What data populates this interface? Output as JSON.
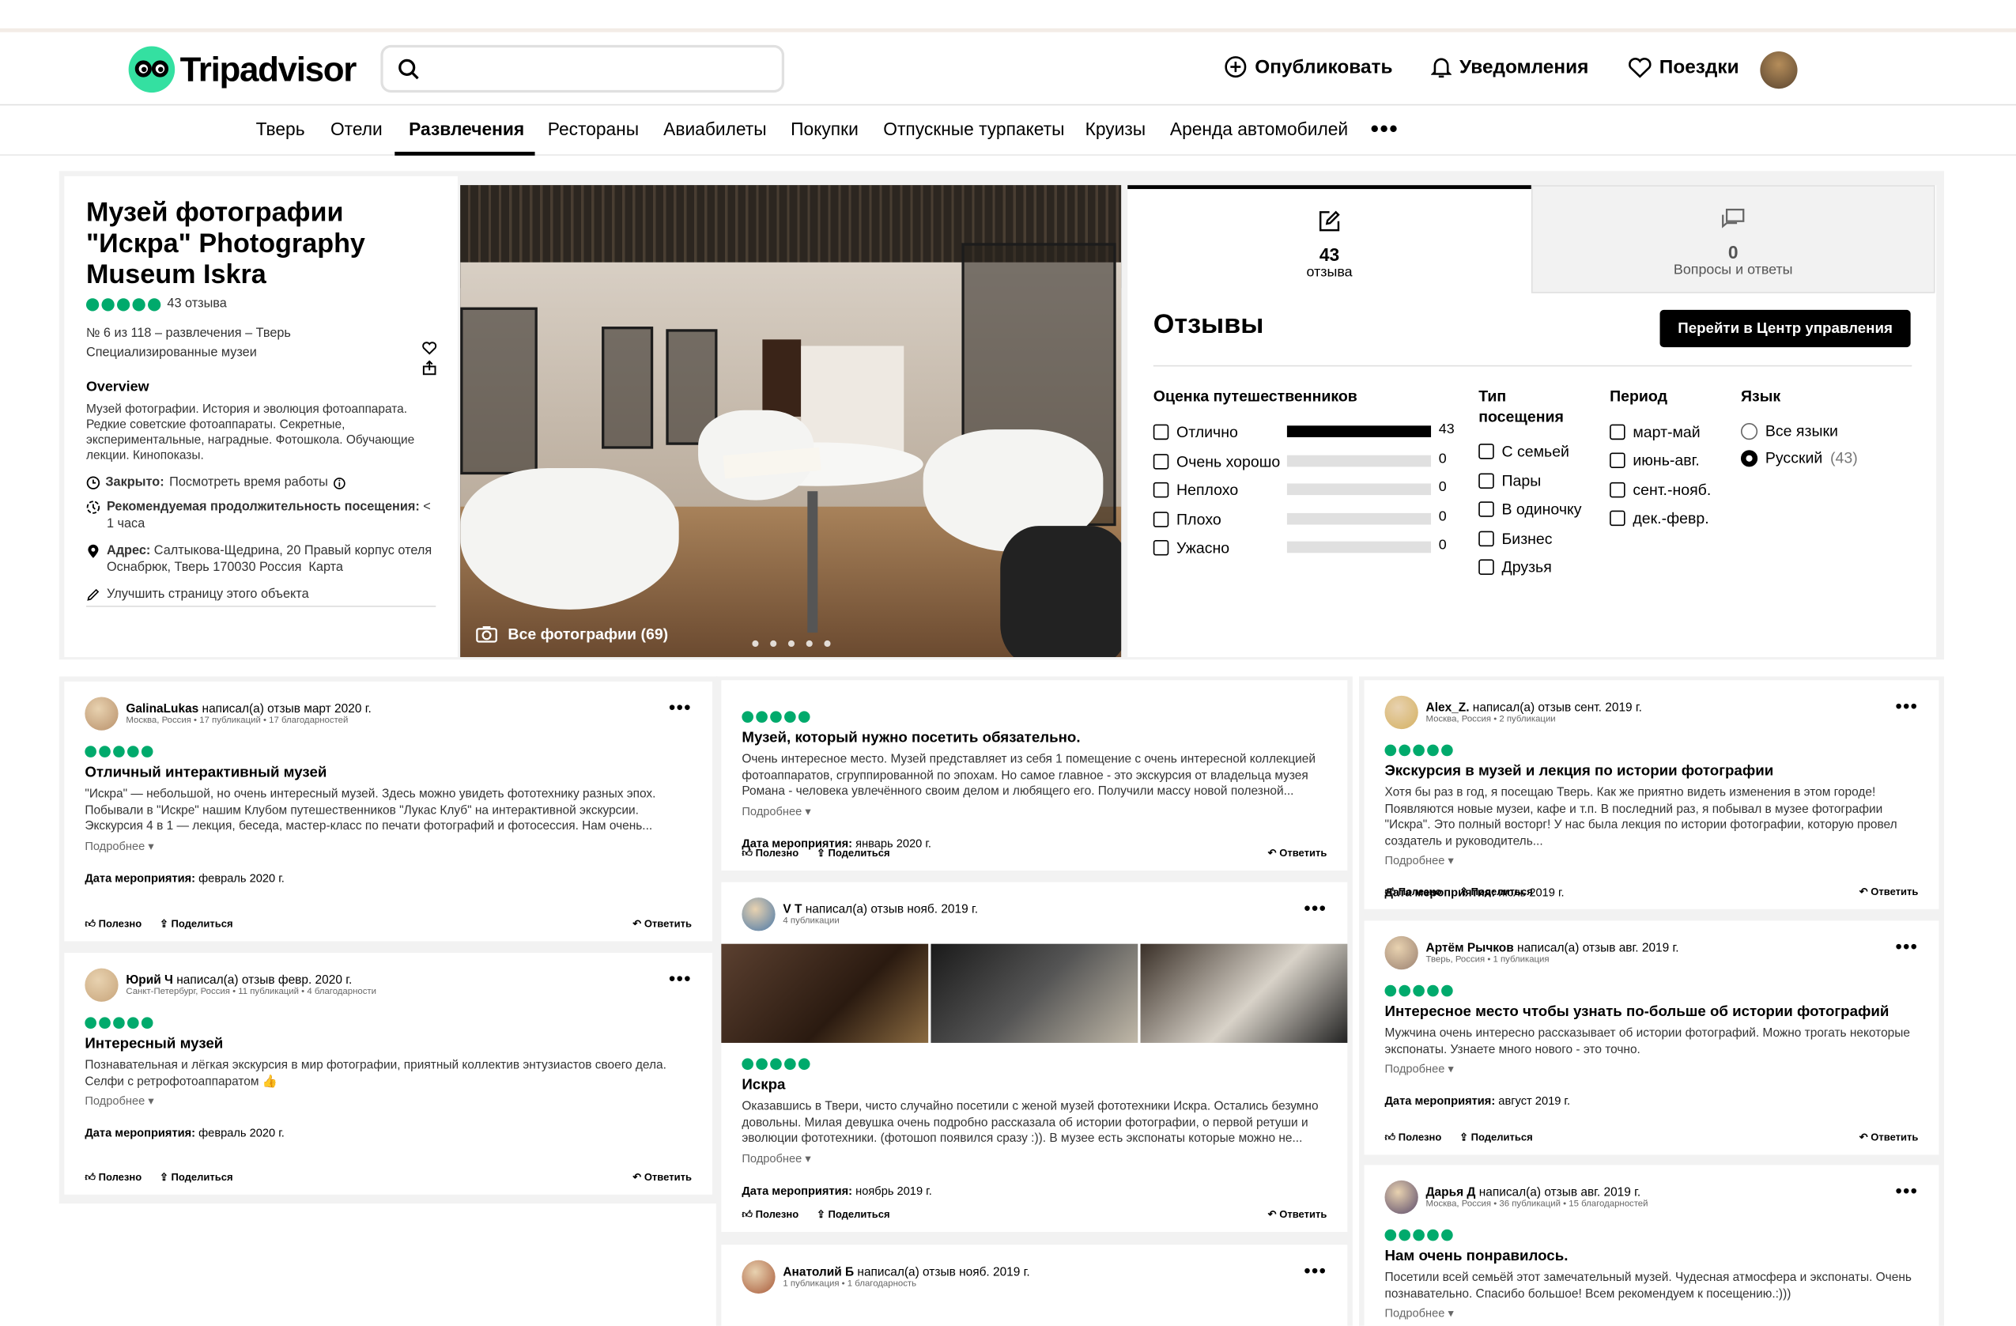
{
  "header": {
    "logo": "Tripadvisor",
    "search_placeholder": "",
    "actions": [
      {
        "label": "Опубликовать",
        "icon": "plus-circle-icon"
      },
      {
        "label": "Уведомления",
        "icon": "bell-icon"
      },
      {
        "label": "Поездки",
        "icon": "heart-icon"
      }
    ]
  },
  "tabs": [
    "Тверь",
    "Отели",
    "Развлечения",
    "Рестораны",
    "Авиабилеты",
    "Покупки",
    "Отпускные турпакеты",
    "Круизы",
    "Аренда автомобилей"
  ],
  "active_tab": "Развлечения",
  "place": {
    "title": "Музей фотографии \"Искра\" Photography Museum Iskra",
    "reviews_count": "43 отзыва",
    "rank": "№ 6 из 118 – развлечения – Тверь",
    "category": "Специализированные музеи",
    "overview_label": "Overview",
    "overview": "Музей фотографии. История и эволюция фотоаппарата. Редкие советские фотоаппараты. Секретные, экспериментальные, наградные. Фотошкола. Обучающие лекции. Кинопоказы.",
    "closed_label": "Закрыто:",
    "closed_value": "Посмотреть время работы",
    "duration_label": "Рекомендуемая продолжительность посещения:",
    "duration_value": "< 1 часа",
    "address_label": "Адрес:",
    "address_value": "Салтыкова-Щедрина, 20 Правый корпус отеля Оснабрюк, Тверь 170030 Россия",
    "map_link": "Карта",
    "improve": "Улучшить страницу этого объекта"
  },
  "photos": {
    "caption": "Все фотографии (69)",
    "dots": 5
  },
  "review_panel": {
    "tab_reviews_num": "43",
    "tab_reviews_label": "отзыва",
    "tab_qa_num": "0",
    "tab_qa_label": "Вопросы и ответы",
    "heading": "Отзывы",
    "button": "Перейти в Центр управления",
    "rating_title": "Оценка путешественников",
    "ratings": [
      {
        "label": "Отлично",
        "count": "43",
        "fraction": 1
      },
      {
        "label": "Очень хорошо",
        "count": "0",
        "fraction": 0
      },
      {
        "label": "Неплохо",
        "count": "0",
        "fraction": 0
      },
      {
        "label": "Плохо",
        "count": "0",
        "fraction": 0
      },
      {
        "label": "Ужасно",
        "count": "0",
        "fraction": 0
      }
    ],
    "type_title": "Тип посещения",
    "types": [
      "С семьей",
      "Пары",
      "В одиночку",
      "Бизнес",
      "Друзья"
    ],
    "period_title": "Период",
    "periods": [
      "март-май",
      "июнь-авг.",
      "сент.-нояб.",
      "дек.-февр."
    ],
    "lang_title": "Язык",
    "langs": [
      {
        "label": "Все языки",
        "count": ""
      },
      {
        "label": "Русский",
        "count": "(43)"
      }
    ]
  },
  "labels": {
    "more": "Подробнее",
    "date": "Дата мероприятия:",
    "helpful": "Полезно",
    "share": "Поделиться",
    "reply": "Ответить",
    "wrote": "написал(а) отзыв"
  },
  "reviews_col1": [
    {
      "user": "GalinaLukas",
      "when": "март 2020 г.",
      "sub": "Москва, Россия • 17 публикаций • 17 благодарностей",
      "title": "Отличный интерактивный музей",
      "text": "\"Искра\" — небольшой, но очень интересный музей. Здесь можно увидеть фототехнику разных эпох. Побывали в \"Искре\" нашим Клубом путешественников \"Лукас Клуб\" на интерактивной экскурсии. Экскурсия 4 в 1 — лекция, беседа, мастер-класс по печати фотографий и фотосессия. Нам очень...",
      "date": "февраль 2020 г."
    },
    {
      "user": "Юрий Ч",
      "when": "февр. 2020 г.",
      "sub": "Санкт-Петербург, Россия • 11 публикаций • 4 благодарности",
      "title": "Интересный музей",
      "text": "Познавательная и лёгкая экскурсия в мир фотографии, приятный коллектив энтузиастов своего дела. Селфи с ретрофотоаппаратом 👍",
      "date": "февраль 2020 г."
    }
  ],
  "reviews_col2": [
    {
      "title": "Музей, который нужно посетить обязательно.",
      "text": "Очень интересное место. Музей представляет из себя 1 помещение с очень интересной коллекцией фотоаппаратов, сгруппированной по эпохам. Но самое главное - это экскурсия от владельца музея Романа - человека увлечённого своим делом и любящего его. Получили массу новой полезной...",
      "date": "январь 2020 г."
    },
    {
      "user": "V T",
      "when": "нояб. 2019 г.",
      "sub": "4 публикации",
      "title": "Искра",
      "text": "Оказавшись в Твери, чисто случайно посетили с женой музей фототехники Искра. Остались безумно довольны. Милая девушка очень подробно рассказала об истории фотографии, о первой ретуши и эволюции фототехники. (фотошоп появился сразу :)). В музее есть экспонаты которые можно не...",
      "date": "ноябрь 2019 г."
    },
    {
      "user": "Анатолий Б",
      "when": "нояб. 2019 г.",
      "sub": "1 публикация • 1 благодарность"
    }
  ],
  "reviews_col3": [
    {
      "user": "Alex_Z.",
      "when": "сент. 2019 г.",
      "sub": "Москва, Россия • 2 публикации",
      "title": "Экскурсия в музей и лекция по истории фотографии",
      "text": "Хотя бы раз в год, я посещаю Тверь. Как же приятно видеть изменения в этом городе! Появляются новые музеи, кафе и т.п. В последний раз, я побывал в музее фотографии \"Искра\". Это полный восторг! У нас была лекция по истории фотографии, которую провел создатель и руководитель...",
      "date": "июль 2019 г."
    },
    {
      "user": "Артём Рычков",
      "when": "авг. 2019 г.",
      "sub": "Тверь, Россия • 1 публикация",
      "title": "Интересное место чтобы узнать по-больше об истории фотографий",
      "text": "Мужчина очень интересно рассказывает об истории фотографий. Можно трогать некоторые экспонаты. Узнаете много нового - это точно.",
      "date": "август 2019 г."
    },
    {
      "user": "Дарья Д",
      "when": "авг. 2019 г.",
      "sub": "Москва, Россия • 36 публикаций • 15 благодарностей",
      "title": "Нам очень понравилось.",
      "text": "Посетили всей семьёй этот замечательный музей. Чудесная атмосфера и экспонаты. Очень познавательно. Спасибо большое! Всем рекомендуем к посещению.:)))"
    }
  ],
  "colors": {
    "accent": "#00aa6c",
    "logo": "#34e0a1"
  }
}
